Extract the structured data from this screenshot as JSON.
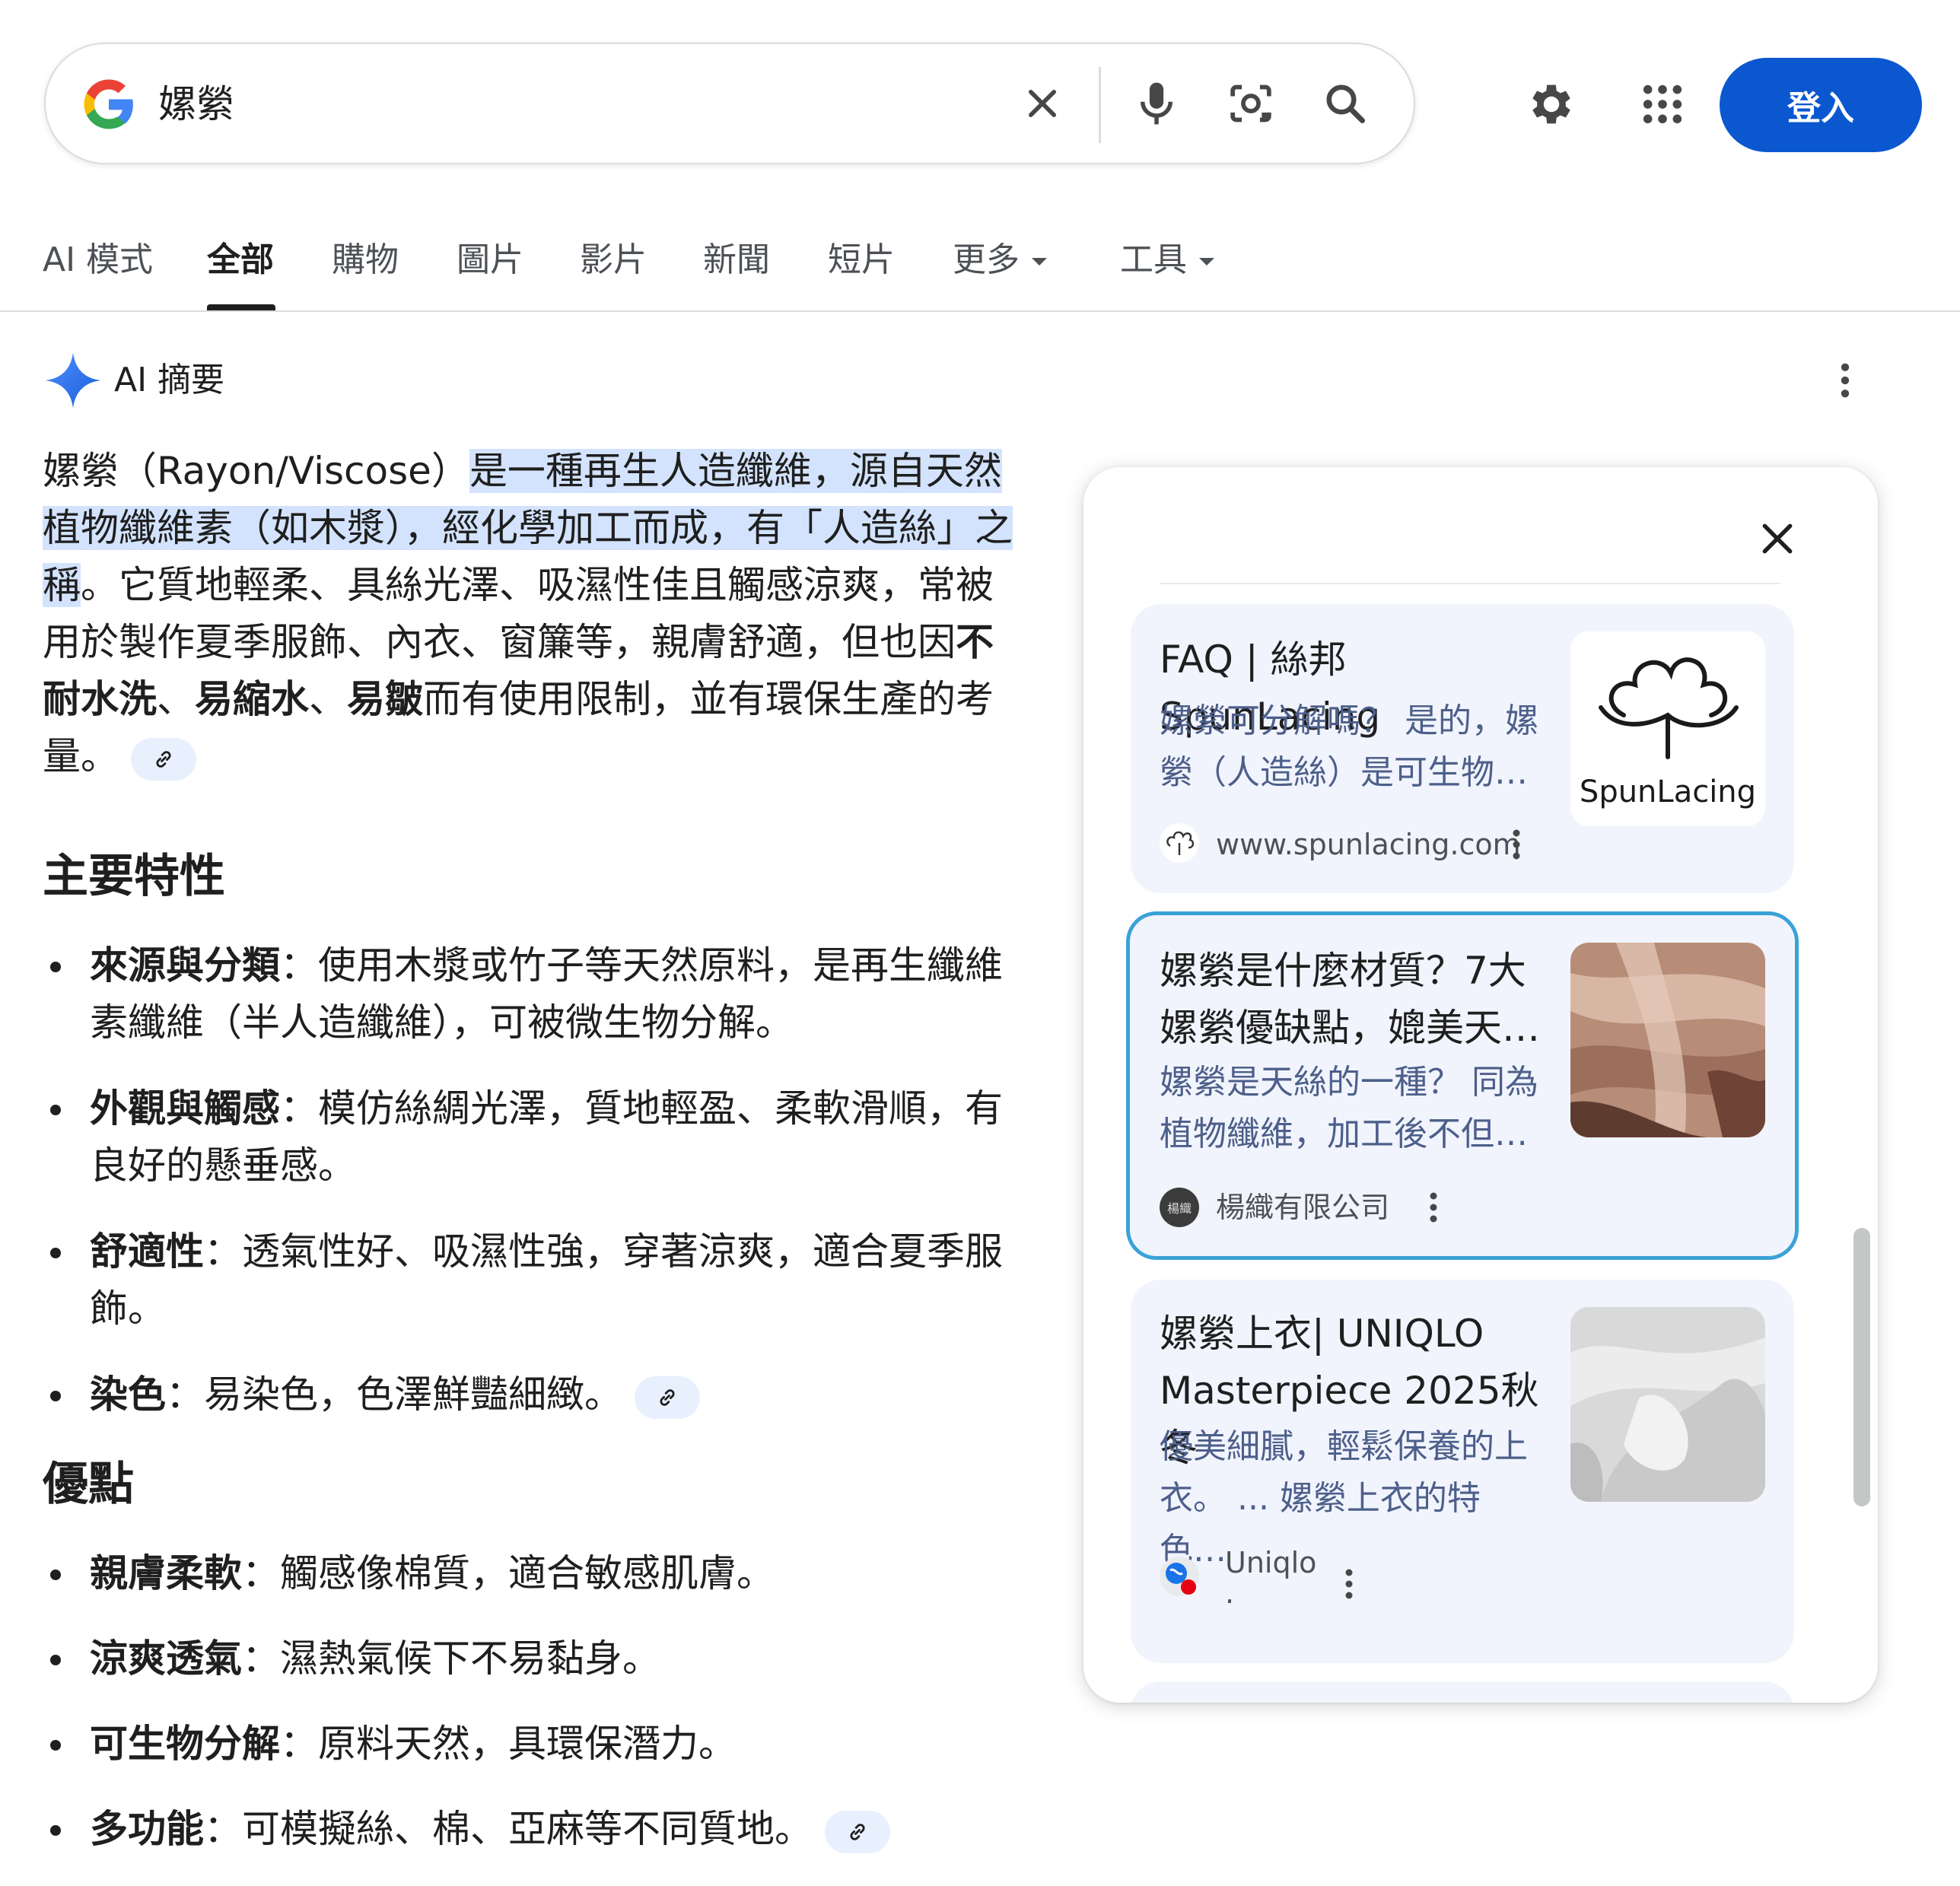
{
  "search": {
    "query": "嫘縈",
    "signin_label": "登入"
  },
  "tabs": [
    {
      "label": "AI 模式"
    },
    {
      "label": "全部",
      "active": true
    },
    {
      "label": "購物"
    },
    {
      "label": "圖片"
    },
    {
      "label": "影片"
    },
    {
      "label": "新聞"
    },
    {
      "label": "短片"
    },
    {
      "label": "更多"
    },
    {
      "label": "工具"
    }
  ],
  "ai": {
    "title": "AI 摘要",
    "intro": {
      "p1": "嫘縈（Rayon/Viscose）",
      "highlight": "是一種再生人造纖維，源自天然植物纖維素（如木漿），經化學加工而成，有「人造絲」之稱",
      "p2": "。它質地輕柔、具絲光澤、吸濕性佳且觸感涼爽，常被用於製作夏季服飾、內衣、窗簾等，親膚舒適，但也因",
      "b1": "不耐水洗",
      "sep1": "、",
      "b2": "易縮水",
      "sep2": "、",
      "b3": "易皺",
      "p3": "而有使用限制，並有環保生產的考量。"
    },
    "section1_title": "主要特性",
    "section1_items": [
      {
        "term": "來源與分類",
        "text": "：使用木漿或竹子等天然原料，是再生纖維素纖維（半人造纖維），可被微生物分解。"
      },
      {
        "term": "外觀與觸感",
        "text": "：模仿絲綢光澤，質地輕盈、柔軟滑順，有良好的懸垂感。"
      },
      {
        "term": "舒適性",
        "text": "：透氣性好、吸濕性強，穿著涼爽，適合夏季服飾。"
      },
      {
        "term": "染色",
        "text": "：易染色，色澤鮮豔細緻。"
      }
    ],
    "section2_title": "優點",
    "section2_items": [
      {
        "term": "親膚柔軟",
        "text": "：觸感像棉質，適合敏感肌膚。"
      },
      {
        "term": "涼爽透氣",
        "text": "：濕熱氣候下不易黏身。"
      },
      {
        "term": "可生物分解",
        "text": "：原料天然，具環保潛力。"
      },
      {
        "term": "多功能",
        "text": "：可模擬絲、棉、亞麻等不同質地。"
      }
    ]
  },
  "sources": [
    {
      "title": "FAQ | 絲邦SpunLacing",
      "snippet": "嫘縈可分解嗎？ 是的，嫘縈（人造絲）是可生物…",
      "site": "www.spunlacing.com",
      "thumb_text": "SpunLacing"
    },
    {
      "title": "嫘縈是什麼材質？7大嫘縈優缺點，媲美天…",
      "snippet": "嫘縈是天絲的一種？ 同為植物纖維，加工後不但…",
      "site": "楊織有限公司"
    },
    {
      "title": "嫘縈上衣| UNIQLO Masterpiece 2025秋冬",
      "snippet": "優美細膩，輕鬆保養的上衣。 ... 嫘縈上衣的特色…",
      "site": "Uniqlo",
      "site_suffix": "."
    }
  ],
  "colors": {
    "accent": "#0b57d0",
    "highlight": "#d3e3fd",
    "card_bg": "#f1f4fc",
    "selected_border": "#3ba2d8"
  }
}
